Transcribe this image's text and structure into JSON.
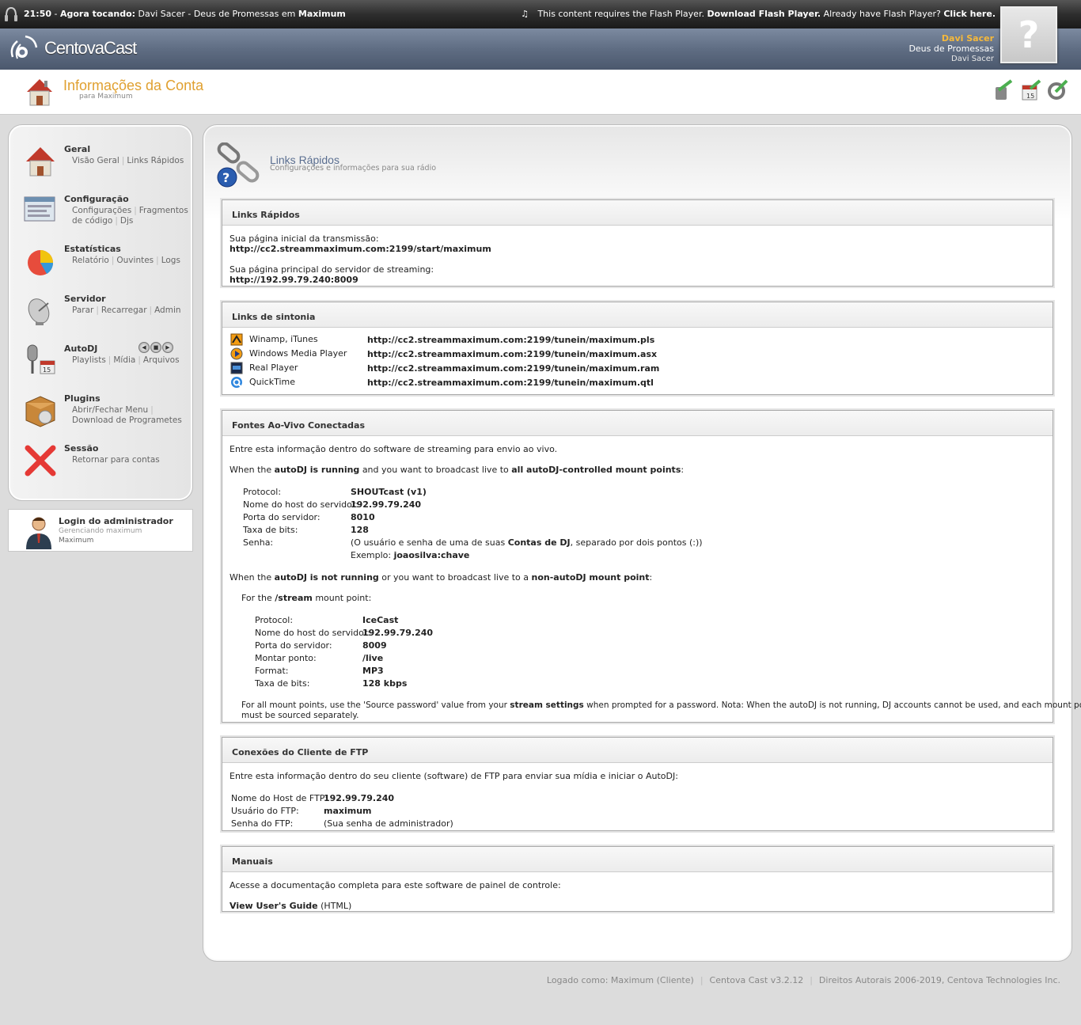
{
  "topbar": {
    "time": "21:50",
    "now_playing_label": "Agora tocando:",
    "track": "Davi Sacer - Deus de Promessas",
    "em": "em",
    "station": "Maximum",
    "flash_text": "This content requires the Flash Player.",
    "flash_download": "Download Flash Player.",
    "flash_have": "Already have Flash Player?",
    "flash_click": "Click here."
  },
  "header": {
    "logo_text": "CentovaCast",
    "artist": "Davi Sacer",
    "song": "Deus de Promessas",
    "artist_small": "Davi Sacer",
    "album_art_placeholder": "?"
  },
  "title": {
    "main": "Informações da Conta",
    "sub": "para Maximum"
  },
  "sidebar": {
    "groups": [
      {
        "title": "Geral",
        "links": [
          "Visão Geral",
          "Links Rápidos"
        ]
      },
      {
        "title": "Configuração",
        "links": [
          "Configurações",
          "Fragmentos de código",
          "Djs"
        ]
      },
      {
        "title": "Estatísticas",
        "links": [
          "Relatório",
          "Ouvintes",
          "Logs"
        ]
      },
      {
        "title": "Servidor",
        "links": [
          "Parar",
          "Recarregar",
          "Admin"
        ]
      },
      {
        "title": "AutoDJ",
        "links": [
          "Playlists",
          "Mídia",
          "Arquivos"
        ]
      },
      {
        "title": "Plugins",
        "links": [
          "Abrir/Fechar Menu",
          "Download de Programetes"
        ]
      },
      {
        "title": "Sessão",
        "links": [
          "Retornar para contas"
        ]
      }
    ],
    "admin": {
      "name": "Login do administrador",
      "managing": "Gerenciando maximum",
      "account": "Maximum"
    }
  },
  "section": {
    "title": "Links Rápidos",
    "subtitle": "Configurações e informações para sua rádio"
  },
  "quick_links": {
    "header": "Links Rápidos",
    "start_label": "Sua página inicial da transmissão:",
    "start_url": "http://cc2.streammaximum.com:2199/start/maximum",
    "server_label": "Sua página principal do servidor de streaming:",
    "server_url": "http://192.99.79.240:8009"
  },
  "tunein": {
    "header": "Links de sintonia",
    "rows": [
      {
        "player": "Winamp, iTunes",
        "url": "http://cc2.streammaximum.com:2199/tunein/maximum.pls"
      },
      {
        "player": "Windows Media Player",
        "url": "http://cc2.streammaximum.com:2199/tunein/maximum.asx"
      },
      {
        "player": "Real Player",
        "url": "http://cc2.streammaximum.com:2199/tunein/maximum.ram"
      },
      {
        "player": "QuickTime",
        "url": "http://cc2.streammaximum.com:2199/tunein/maximum.qtl"
      }
    ]
  },
  "live": {
    "header": "Fontes Ao-Vivo Conectadas",
    "intro": "Entre esta informação dentro do software de streaming para envio ao vivo.",
    "running_pre": "When the",
    "running_b1": "autoDJ is running",
    "running_mid": "and you want to broadcast live to",
    "running_b2": "all autoDJ-controlled mount points",
    "running_end": ":",
    "protocol_label": "Protocol:",
    "protocol_value": "SHOUTcast (v1)",
    "host_label": "Nome do host do servidor:",
    "host_value": "192.99.79.240",
    "port_label": "Porta do servidor:",
    "port_value": "8010",
    "bitrate_label": "Taxa de bits:",
    "bitrate_value": "128",
    "password_label": "Senha:",
    "password_pre": "(O usuário e senha de uma de suas",
    "password_b": "Contas de DJ",
    "password_post": ", separado por dois pontos (:))",
    "example_label": "Exemplo:",
    "example_value": "joaosilva:chave",
    "notrunning_pre": "When the",
    "notrunning_b1": "autoDJ is not running",
    "notrunning_mid": "or you want to broadcast live to a",
    "notrunning_b2": "non-autoDJ mount point",
    "notrunning_end": ":",
    "forthe_pre": "For the",
    "forthe_b": "/stream",
    "forthe_post": "mount point:",
    "m_protocol_label": "Protocol:",
    "m_protocol_value": "IceCast",
    "m_host_label": "Nome do host do servidor:",
    "m_host_value": "192.99.79.240",
    "m_port_label": "Porta do servidor:",
    "m_port_value": "8009",
    "m_mount_label": "Montar ponto:",
    "m_mount_value": "/live",
    "m_format_label": "Format:",
    "m_format_value": "MP3",
    "m_bitrate_label": "Taxa de bits:",
    "m_bitrate_value": "128 kbps",
    "note_pre": "For all mount points, use the 'Source password' value from your",
    "note_b": "stream settings",
    "note_post": "when prompted for a password. Nota: When the autoDJ is not running, DJ accounts cannot be used, and each mount point",
    "note_line2": "must be sourced separately."
  },
  "ftp": {
    "header": "Conexões do Cliente de FTP",
    "intro": "Entre esta informação dentro do seu cliente (software) de FTP para enviar sua mídia e iniciar o AutoDJ:",
    "host_label": "Nome do Host de FTP:",
    "host_value": "192.99.79.240",
    "user_label": "Usuário do FTP:",
    "user_value": "maximum",
    "pass_label": "Senha do FTP:",
    "pass_value": "(Sua senha de administrador)"
  },
  "manuals": {
    "header": "Manuais",
    "intro": "Acesse a documentação completa para este software de painel de controle:",
    "guide_link": "View User's Guide",
    "guide_format": "(HTML)"
  },
  "footer": {
    "logged": "Logado como: Maximum (Cliente)",
    "version": "Centova Cast v3.2.12",
    "copyright": "Direitos Autorais 2006-2019, Centova Technologies Inc."
  }
}
